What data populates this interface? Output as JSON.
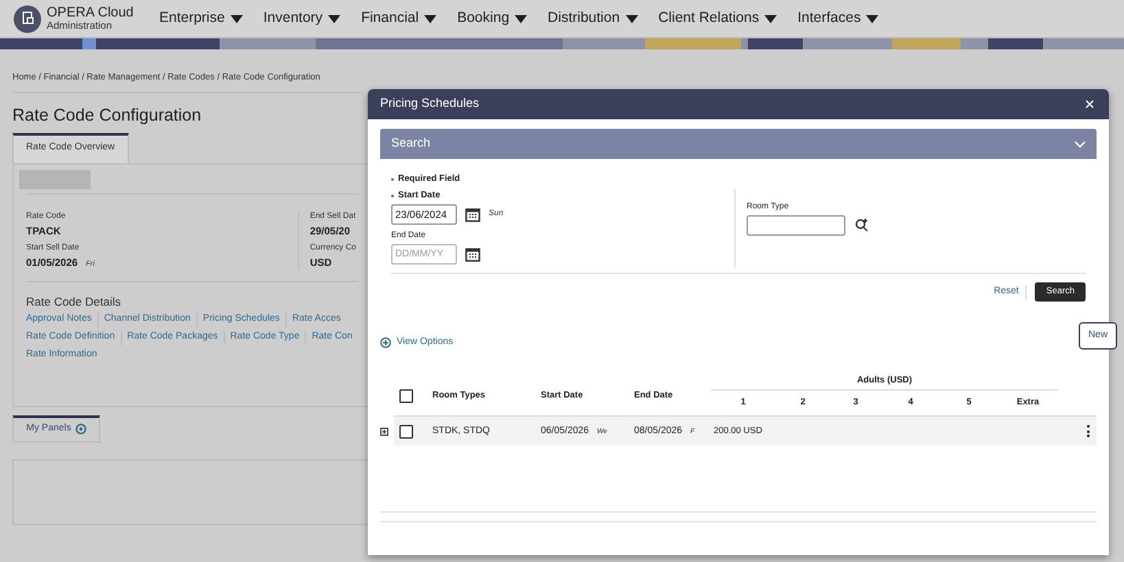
{
  "header": {
    "title": "OPERA Cloud",
    "subtitle": "Administration",
    "menu": [
      {
        "label": "Enterprise"
      },
      {
        "label": "Inventory"
      },
      {
        "label": "Financial"
      },
      {
        "label": "Booking"
      },
      {
        "label": "Distribution"
      },
      {
        "label": "Client Relations"
      },
      {
        "label": "Interfaces"
      }
    ]
  },
  "breadcrumb": "Home / Financial / Rate Management / Rate Codes / Rate Code Configuration",
  "page_title": "Rate Code Configuration",
  "tabs": [
    {
      "label": "Rate Code Overview",
      "selected": true
    }
  ],
  "overview": {
    "left": [
      {
        "label": "Rate Code",
        "value": "TPACK"
      },
      {
        "label": "Start Sell Date",
        "value": "01/05/2026",
        "day": "Fri"
      }
    ],
    "right": [
      {
        "label": "End Sell Dat",
        "value": "29/05/20"
      },
      {
        "label": "Currency Co",
        "value": "USD"
      }
    ]
  },
  "details": {
    "title": "Rate Code Details",
    "rows": [
      [
        "Approval Notes",
        "Channel Distribution",
        "Pricing Schedules",
        "Rate Acces"
      ],
      [
        "Rate Code Definition",
        "Rate Code Packages",
        "Rate Code Type",
        "Rate Con"
      ],
      [
        "Rate Information"
      ]
    ]
  },
  "my_panels": {
    "label": "My Panels"
  },
  "modal": {
    "title": "Pricing Schedules",
    "search_title": "Search",
    "expanded": true,
    "required_note": "Required Field",
    "start_date": {
      "label": "Start Date",
      "value": "23/06/2024",
      "day": "Sun"
    },
    "end_date": {
      "label": "End Date",
      "placeholder": "DD/MM/YY"
    },
    "room_type": {
      "label": "Room Type"
    },
    "reset": "Reset",
    "search": "Search",
    "view_options": "View Options",
    "table": {
      "columns": [
        "Room Types",
        "Start Date",
        "End Date"
      ],
      "group": "Adults (USD)",
      "sub_columns": [
        "1",
        "2",
        "3",
        "4",
        "5",
        "Extra"
      ],
      "rows": [
        {
          "checked": false,
          "room_types": "STDK, STDQ",
          "start_date": "06/05/2026",
          "start_day": "We",
          "end_date": "08/05/2026",
          "end_day": "F",
          "prices": [
            "200.00 USD"
          ]
        }
      ],
      "select_all_checked": false
    }
  },
  "new_tooltip": "New"
}
